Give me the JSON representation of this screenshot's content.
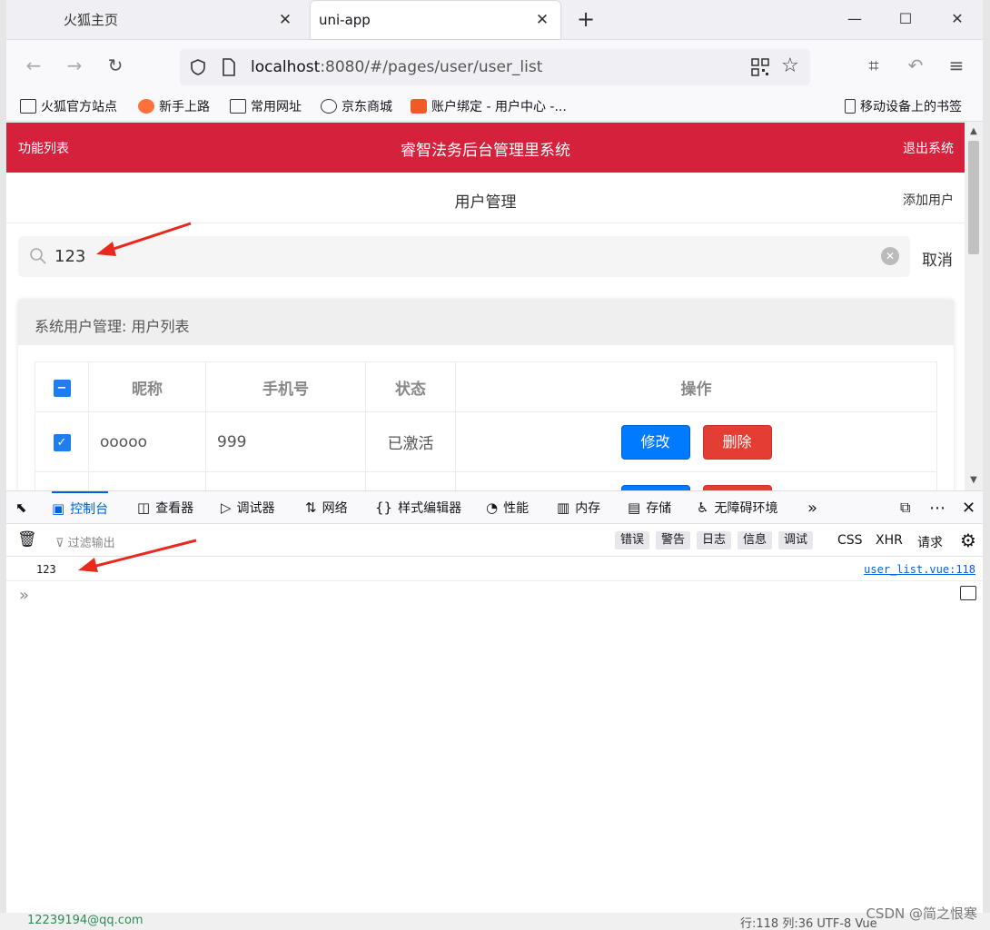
{
  "browser": {
    "tabs": [
      {
        "label": "火狐主页",
        "active": false
      },
      {
        "label": "uni-app",
        "active": true
      }
    ],
    "url_host": "localhost",
    "url_rest": ":8080/#/pages/user/user_list",
    "bookmarks": [
      "火狐官方站点",
      "新手上路",
      "常用网址",
      "京东商城",
      "账户绑定 - 用户中心 -...",
      "移动设备上的书签"
    ]
  },
  "app": {
    "header": {
      "left": "功能列表",
      "title": "睿智法务后台管理里系统",
      "right": "退出系统"
    },
    "subheader": {
      "title": "用户管理",
      "right": "添加用户"
    },
    "search": {
      "value": "123",
      "cancel": "取消"
    },
    "panel_title": "系统用户管理: 用户列表",
    "table": {
      "columns": [
        "昵称",
        "手机号",
        "状态",
        "操作"
      ],
      "rows": [
        {
          "nickname": "ooooo",
          "phone": "999",
          "status": "已激活",
          "checked": true
        }
      ],
      "edit_label": "修改",
      "delete_label": "删除"
    }
  },
  "devtools": {
    "tabs": [
      "控制台",
      "查看器",
      "调试器",
      "网络",
      "样式编辑器",
      "性能",
      "内存",
      "存储",
      "无障碍环境"
    ],
    "active_tab": "控制台",
    "filter_placeholder": "过滤输出",
    "levels": [
      "错误",
      "警告",
      "日志",
      "信息",
      "调试"
    ],
    "requests": [
      "CSS",
      "XHR",
      "请求"
    ],
    "log": {
      "message": "123",
      "source": "user_list.vue:118"
    }
  },
  "ide_strip": {
    "text": "12239194@qq.com",
    "status": "行:118  列:36    UTF-8    Vue"
  },
  "watermark": "CSDN @简之恨寒",
  "colors": {
    "brand_red": "#d5213c",
    "primary_blue": "#007aff",
    "danger_red": "#e43d33",
    "devtools_blue": "#0060df"
  }
}
